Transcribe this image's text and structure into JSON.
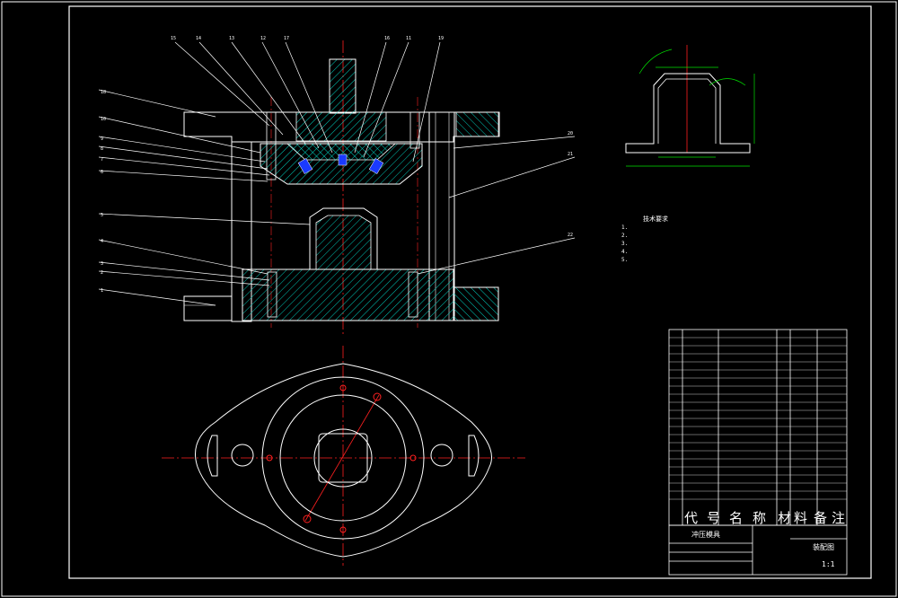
{
  "drawing": {
    "notes": {
      "title": "技术要求",
      "lines": [
        "1.",
        "2.",
        "3.",
        "4.",
        "5."
      ]
    },
    "bom_header": [
      "代",
      "号",
      "名",
      "称",
      "材",
      "料",
      "备",
      "注"
    ],
    "title_block": {
      "drawing_name": "冲压模具",
      "drawing_no": "装配图",
      "scale": "1:1"
    },
    "colors": {
      "background": "#000000",
      "outline": "#ffffff",
      "centerline": "#ff2020",
      "hatch": "#00d0c0",
      "dimension": "#00e000",
      "leader": "#ffffff",
      "frame": "#ffffff"
    }
  }
}
